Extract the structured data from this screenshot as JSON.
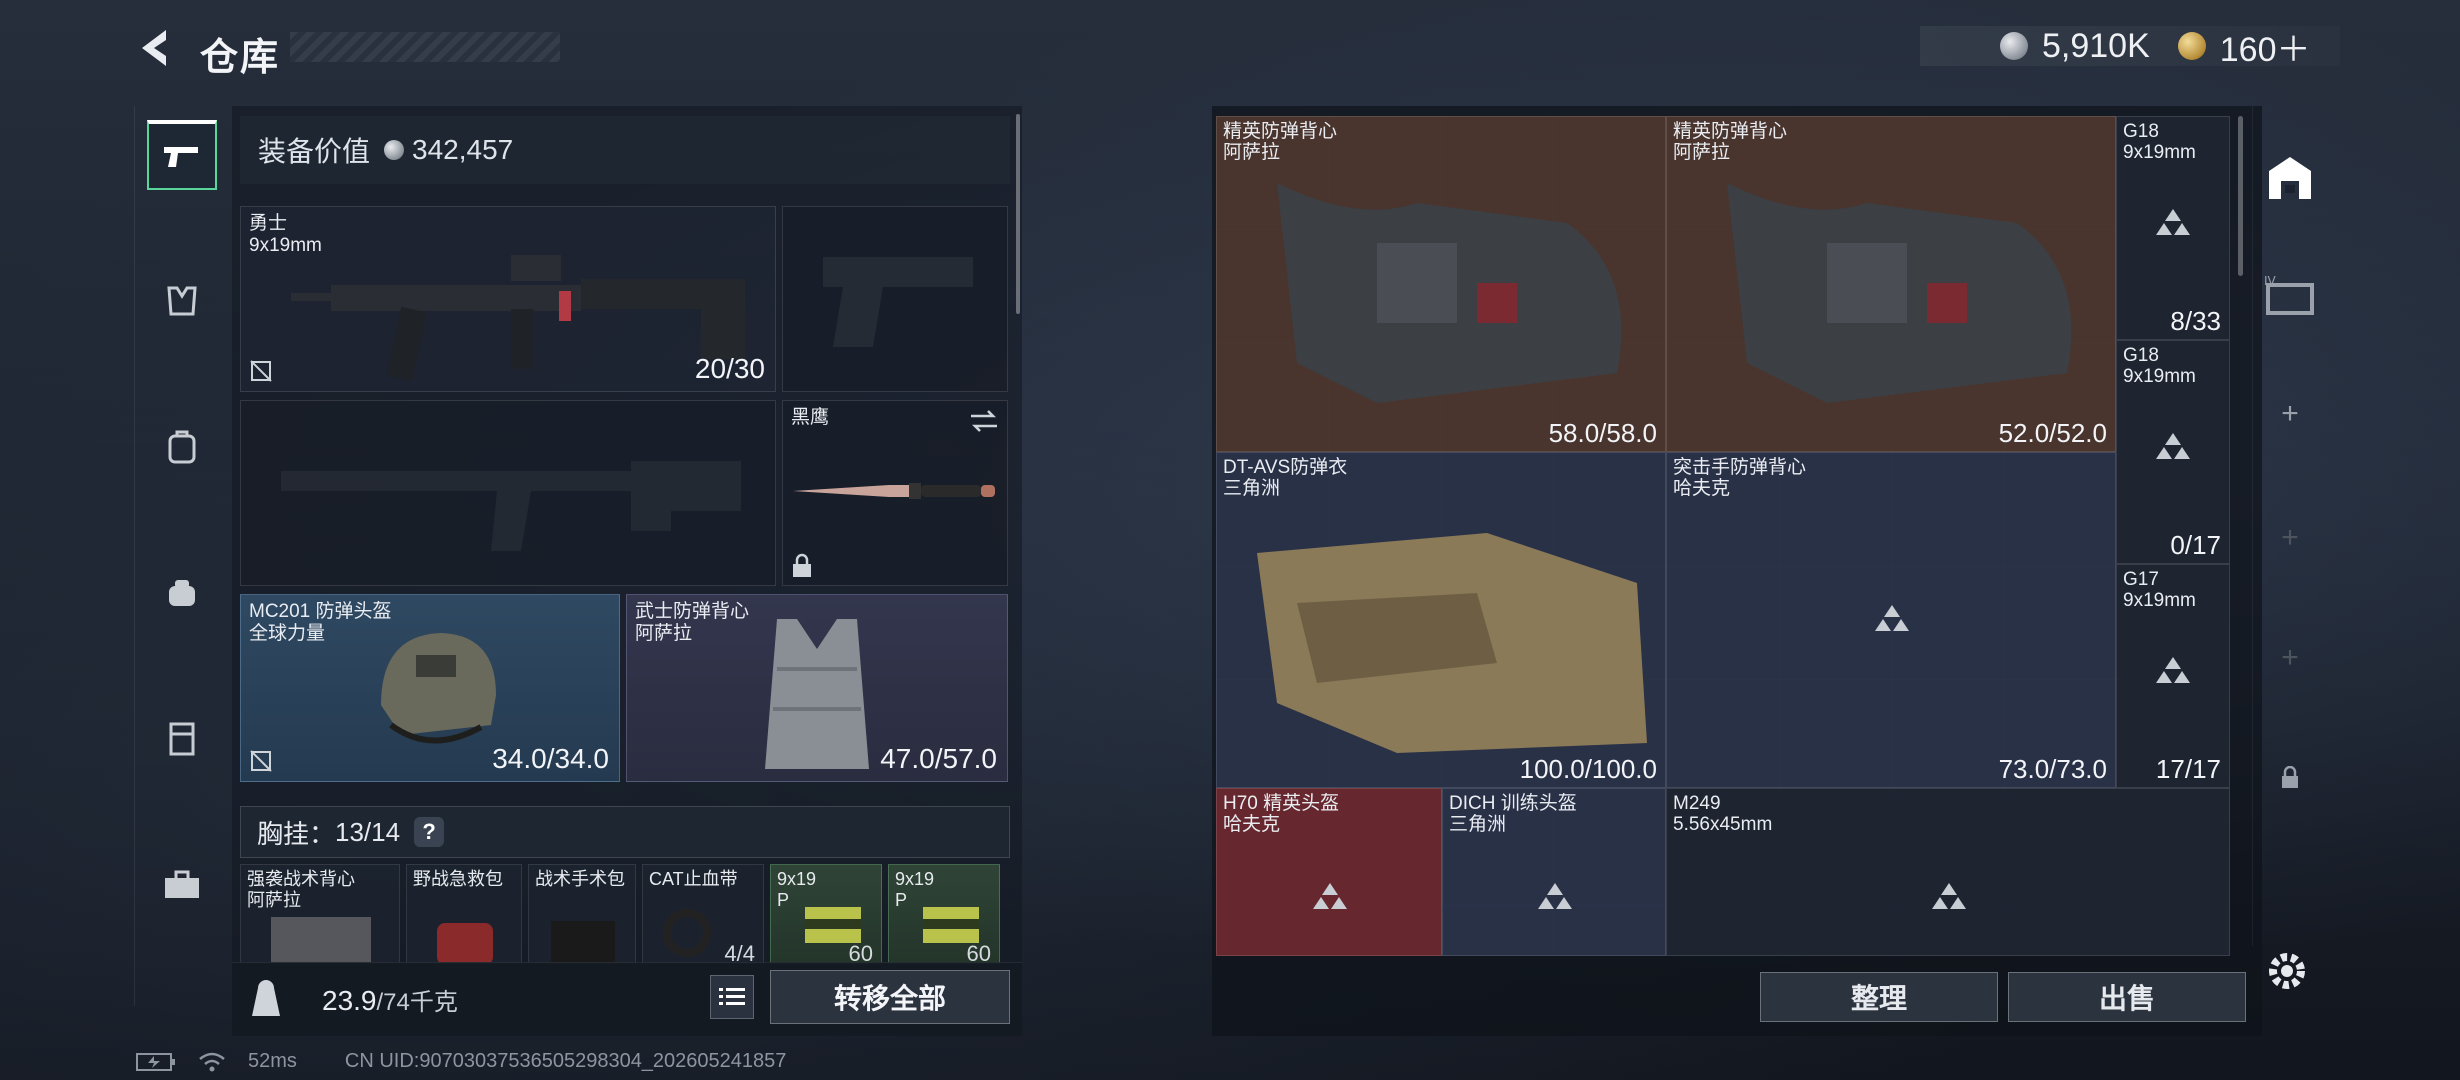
{
  "header": {
    "title": "仓库",
    "silver_amount": "5,910K",
    "gold_amount": "160＋"
  },
  "loadout": {
    "value_label": "装备价值",
    "value_amount": "342,457",
    "primary": {
      "name": "勇士",
      "caliber": "9x19mm",
      "ammo": "20/30"
    },
    "melee": {
      "name": "黑鹰"
    },
    "helmet": {
      "name": "MC201 防弹头盔",
      "faction": "全球力量",
      "durability": "34.0/34.0"
    },
    "armor": {
      "name": "武士防弹背心",
      "faction": "阿萨拉",
      "durability": "47.0/57.0"
    },
    "chest_label": "胸挂：",
    "chest_count": "13/14",
    "chest_help": "?",
    "chest_items": [
      {
        "name": "强袭战术背心",
        "sub": "阿萨拉",
        "count": ""
      },
      {
        "name": "野战急救包",
        "sub": "",
        "count": ""
      },
      {
        "name": "战术手术包",
        "sub": "",
        "count": ""
      },
      {
        "name": "CAT止血带",
        "sub": "",
        "count": "4/4"
      },
      {
        "name": "9x19",
        "sub": "P",
        "count": "60"
      },
      {
        "name": "9x19",
        "sub": "P",
        "count": "60"
      }
    ],
    "weight_value": "23.9",
    "weight_max": "/74千克",
    "transfer_all": "转移全部"
  },
  "storage": {
    "items": [
      {
        "name": "精英防弹背心",
        "sub": "阿萨拉",
        "count": "58.0/58.0"
      },
      {
        "name": "精英防弹背心",
        "sub": "阿萨拉",
        "count": "52.0/52.0"
      },
      {
        "name": "G18",
        "sub": "9x19mm",
        "count": "8/33"
      },
      {
        "name": "G18",
        "sub": "9x19mm",
        "count": "0/17"
      },
      {
        "name": "DT-AVS防弹衣",
        "sub": "三角洲",
        "count": "100.0/100.0"
      },
      {
        "name": "突击手防弹背心",
        "sub": "哈夫克",
        "count": "73.0/73.0"
      },
      {
        "name": "G17",
        "sub": "9x19mm",
        "count": "17/17"
      },
      {
        "name": "H70 精英头盔",
        "sub": "哈夫克",
        "count": ""
      },
      {
        "name": "DICH 训练头盔",
        "sub": "三角洲",
        "count": ""
      },
      {
        "name": "M249",
        "sub": "5.56x45mm",
        "count": ""
      }
    ],
    "sort_label": "整理",
    "sell_label": "出售"
  },
  "footer": {
    "ping": "52ms",
    "uid": "CN UID:90703037536505298304_202605241857"
  },
  "colors": {
    "accent": "#5bd69a",
    "brown_rarity": "#50372d",
    "red_rarity": "#6e282e",
    "blue_rarity": "#2f4962",
    "purple_rarity": "#33364d",
    "green_rarity": "#2f4437"
  }
}
